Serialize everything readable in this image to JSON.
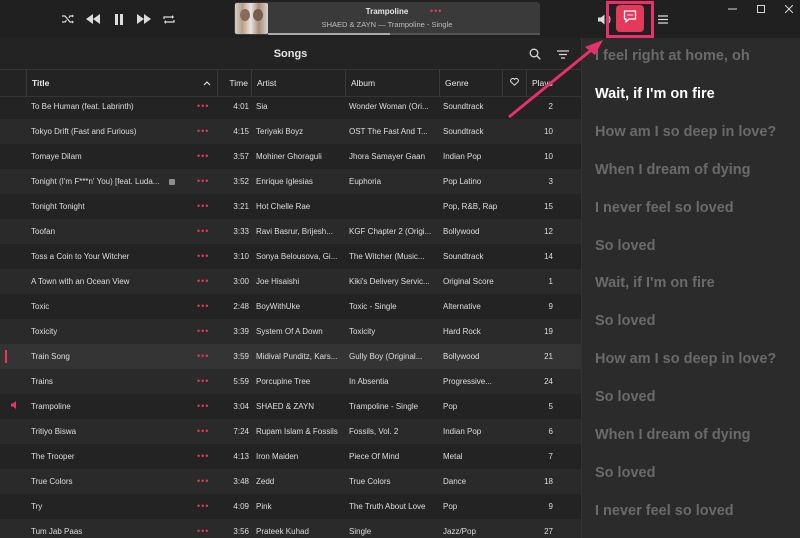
{
  "player": {
    "title": "Trampoline",
    "more": "•••",
    "subtitle": "SHAED & ZAYN — Trampoline - Single",
    "progress": 0.45
  },
  "colors": {
    "accent": "#e33a5c",
    "annotation": "#e8316a"
  },
  "icons": {
    "shuffle": "shuffle-icon",
    "previous": "previous-icon",
    "pause": "pause-icon",
    "next": "next-icon",
    "repeat": "repeat-icon",
    "volume": "volume-icon",
    "lyrics": "lyrics-icon",
    "menu": "menu-icon",
    "search": "search-icon",
    "filter": "filter-icon"
  },
  "songs": {
    "title": "Songs",
    "columns": {
      "title": "Title",
      "time": "Time",
      "artist": "Artist",
      "album": "Album",
      "genre": "Genre",
      "plays": "Plays"
    },
    "rows": [
      {
        "title": "To Be Human (feat. Labrinth)",
        "more": "•••",
        "time": "4:01",
        "artist": "Sia",
        "album": "Wonder Woman (Ori...",
        "genre": "Soundtrack",
        "plays": "2"
      },
      {
        "title": "Tokyo Drift (Fast and Furious)",
        "more": "•••",
        "time": "4:15",
        "artist": "Teriyaki Boyz",
        "album": "OST The Fast And T...",
        "genre": "Soundtrack",
        "plays": "10"
      },
      {
        "title": "Tomaye Dilam",
        "more": "•••",
        "time": "3:57",
        "artist": "Mohiner Ghoraguli",
        "album": "Jhora Samayer Gaan",
        "genre": "Indian Pop",
        "plays": "10"
      },
      {
        "title": "Tonight (I'm F***n' You) [feat. Luda...",
        "more": "•••",
        "time": "3:52",
        "artist": "Enrique Iglesias",
        "album": "Euphoria",
        "genre": "Pop Latino",
        "plays": "3",
        "explicit": true
      },
      {
        "title": "Tonight Tonight",
        "more": "•••",
        "time": "3:21",
        "artist": "Hot Chelle Rae",
        "album": "",
        "genre": "Pop, R&B, Rap",
        "plays": "15"
      },
      {
        "title": "Toofan",
        "more": "•••",
        "time": "3:33",
        "artist": "Ravi Basrur, Brijesh...",
        "album": "KGF Chapter 2 (Origi...",
        "genre": "Bollywood",
        "plays": "12"
      },
      {
        "title": "Toss a Coin to Your Witcher",
        "more": "•••",
        "time": "3:10",
        "artist": "Sonya Belousova, Gi...",
        "album": "The Witcher (Music...",
        "genre": "Soundtrack",
        "plays": "14"
      },
      {
        "title": "A Town with an Ocean View",
        "more": "•••",
        "time": "3:00",
        "artist": "Joe Hisaishi",
        "album": "Kiki's Delivery Servic...",
        "genre": "Original Score",
        "plays": "1"
      },
      {
        "title": "Toxic",
        "more": "•••",
        "time": "2:48",
        "artist": "BoyWithUke",
        "album": "Toxic - Single",
        "genre": "Alternative",
        "plays": "9"
      },
      {
        "title": "Toxicity",
        "more": "•••",
        "time": "3:39",
        "artist": "System Of A Down",
        "album": "Toxicity",
        "genre": "Hard Rock",
        "plays": "19"
      },
      {
        "title": "Train Song",
        "more": "•••",
        "time": "3:59",
        "artist": "Midival Punditz, Kars...",
        "album": "Gully Boy (Original...",
        "genre": "Bollywood",
        "plays": "21",
        "selected": true
      },
      {
        "title": "Trains",
        "more": "•••",
        "time": "5:59",
        "artist": "Porcupine Tree",
        "album": "In Absentia",
        "genre": "Progressive...",
        "plays": "24"
      },
      {
        "title": "Trampoline",
        "more": "•••",
        "time": "3:04",
        "artist": "SHAED & ZAYN",
        "album": "Trampoline - Single",
        "genre": "Pop",
        "plays": "5",
        "playing": true
      },
      {
        "title": "Tritiyo Biswa",
        "more": "•••",
        "time": "7:24",
        "artist": "Rupam Islam & Fossils",
        "album": "Fossils, Vol. 2",
        "genre": "Indian Pop",
        "plays": "6"
      },
      {
        "title": "The Trooper",
        "more": "•••",
        "time": "4:13",
        "artist": "Iron Maiden",
        "album": "Piece Of Mind",
        "genre": "Metal",
        "plays": "7"
      },
      {
        "title": "True Colors",
        "more": "•••",
        "time": "3:48",
        "artist": "Zedd",
        "album": "True Colors",
        "genre": "Dance",
        "plays": "18"
      },
      {
        "title": "Try",
        "more": "•••",
        "time": "4:09",
        "artist": "Pink",
        "album": "The Truth About Love",
        "genre": "Pop",
        "plays": "9"
      },
      {
        "title": "Tum Jab Paas",
        "more": "•••",
        "time": "3:56",
        "artist": "Prateek Kuhad",
        "album": "Single",
        "genre": "Jazz/Pop",
        "plays": "27"
      }
    ]
  },
  "lyrics": [
    {
      "text": "I feel right at home, oh"
    },
    {
      "text": "Wait, if I'm on fire",
      "active": true
    },
    {
      "text": "How am I so deep in love?"
    },
    {
      "text": "When I dream of dying"
    },
    {
      "text": "I never feel so loved"
    },
    {
      "text": "So loved"
    },
    {
      "text": "Wait, if I'm on fire"
    },
    {
      "text": "So loved"
    },
    {
      "text": "How am I so deep in love?"
    },
    {
      "text": "So loved"
    },
    {
      "text": "When I dream of dying"
    },
    {
      "text": "So loved"
    },
    {
      "text": "I never feel so loved"
    }
  ]
}
